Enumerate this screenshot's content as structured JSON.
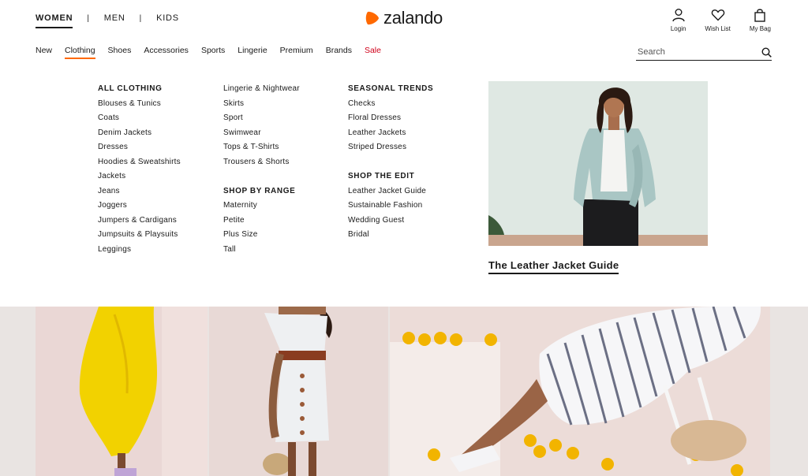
{
  "gender_tabs": [
    {
      "label": "WOMEN",
      "active": true
    },
    {
      "label": "MEN",
      "active": false
    },
    {
      "label": "KIDS",
      "active": false
    }
  ],
  "separator": "|",
  "brand": {
    "name": "zalando",
    "accent_color": "#ff6900"
  },
  "header_icons": [
    {
      "icon": "user-icon",
      "label": "Login"
    },
    {
      "icon": "heart-icon",
      "label": "Wish List"
    },
    {
      "icon": "bag-icon",
      "label": "My Bag"
    }
  ],
  "nav": [
    {
      "label": "New"
    },
    {
      "label": "Clothing",
      "active": true
    },
    {
      "label": "Shoes"
    },
    {
      "label": "Accessories"
    },
    {
      "label": "Sports"
    },
    {
      "label": "Lingerie"
    },
    {
      "label": "Premium"
    },
    {
      "label": "Brands"
    },
    {
      "label": "Sale",
      "color": "#d0021b"
    }
  ],
  "search": {
    "placeholder": "Search",
    "value": ""
  },
  "menu": {
    "col1": {
      "heading": "ALL CLOTHING",
      "items": [
        "Blouses & Tunics",
        "Coats",
        "Denim Jackets",
        "Dresses",
        "Hoodies & Sweatshirts",
        "Jackets",
        "Jeans",
        "Joggers",
        "Jumpers & Cardigans",
        "Jumpsuits & Playsuits",
        "Leggings"
      ]
    },
    "col2": {
      "items": [
        "Lingerie & Nightwear",
        "Skirts",
        "Sport",
        "Swimwear",
        "Tops & T-Shirts",
        "Trousers & Shorts"
      ],
      "heading2": "SHOP BY RANGE",
      "items2": [
        "Maternity",
        "Petite",
        "Plus Size",
        "Tall"
      ]
    },
    "col3": {
      "heading": "SEASONAL TRENDS",
      "items": [
        "Checks",
        "Floral Dresses",
        "Leather Jackets",
        "Striped Dresses"
      ],
      "heading2": "SHOP THE EDIT",
      "items2": [
        "Leather Jacket Guide",
        "Sustainable Fashion",
        "Wedding Guest",
        "Bridal"
      ]
    }
  },
  "promo": {
    "link": "The Leather Jacket Guide"
  }
}
